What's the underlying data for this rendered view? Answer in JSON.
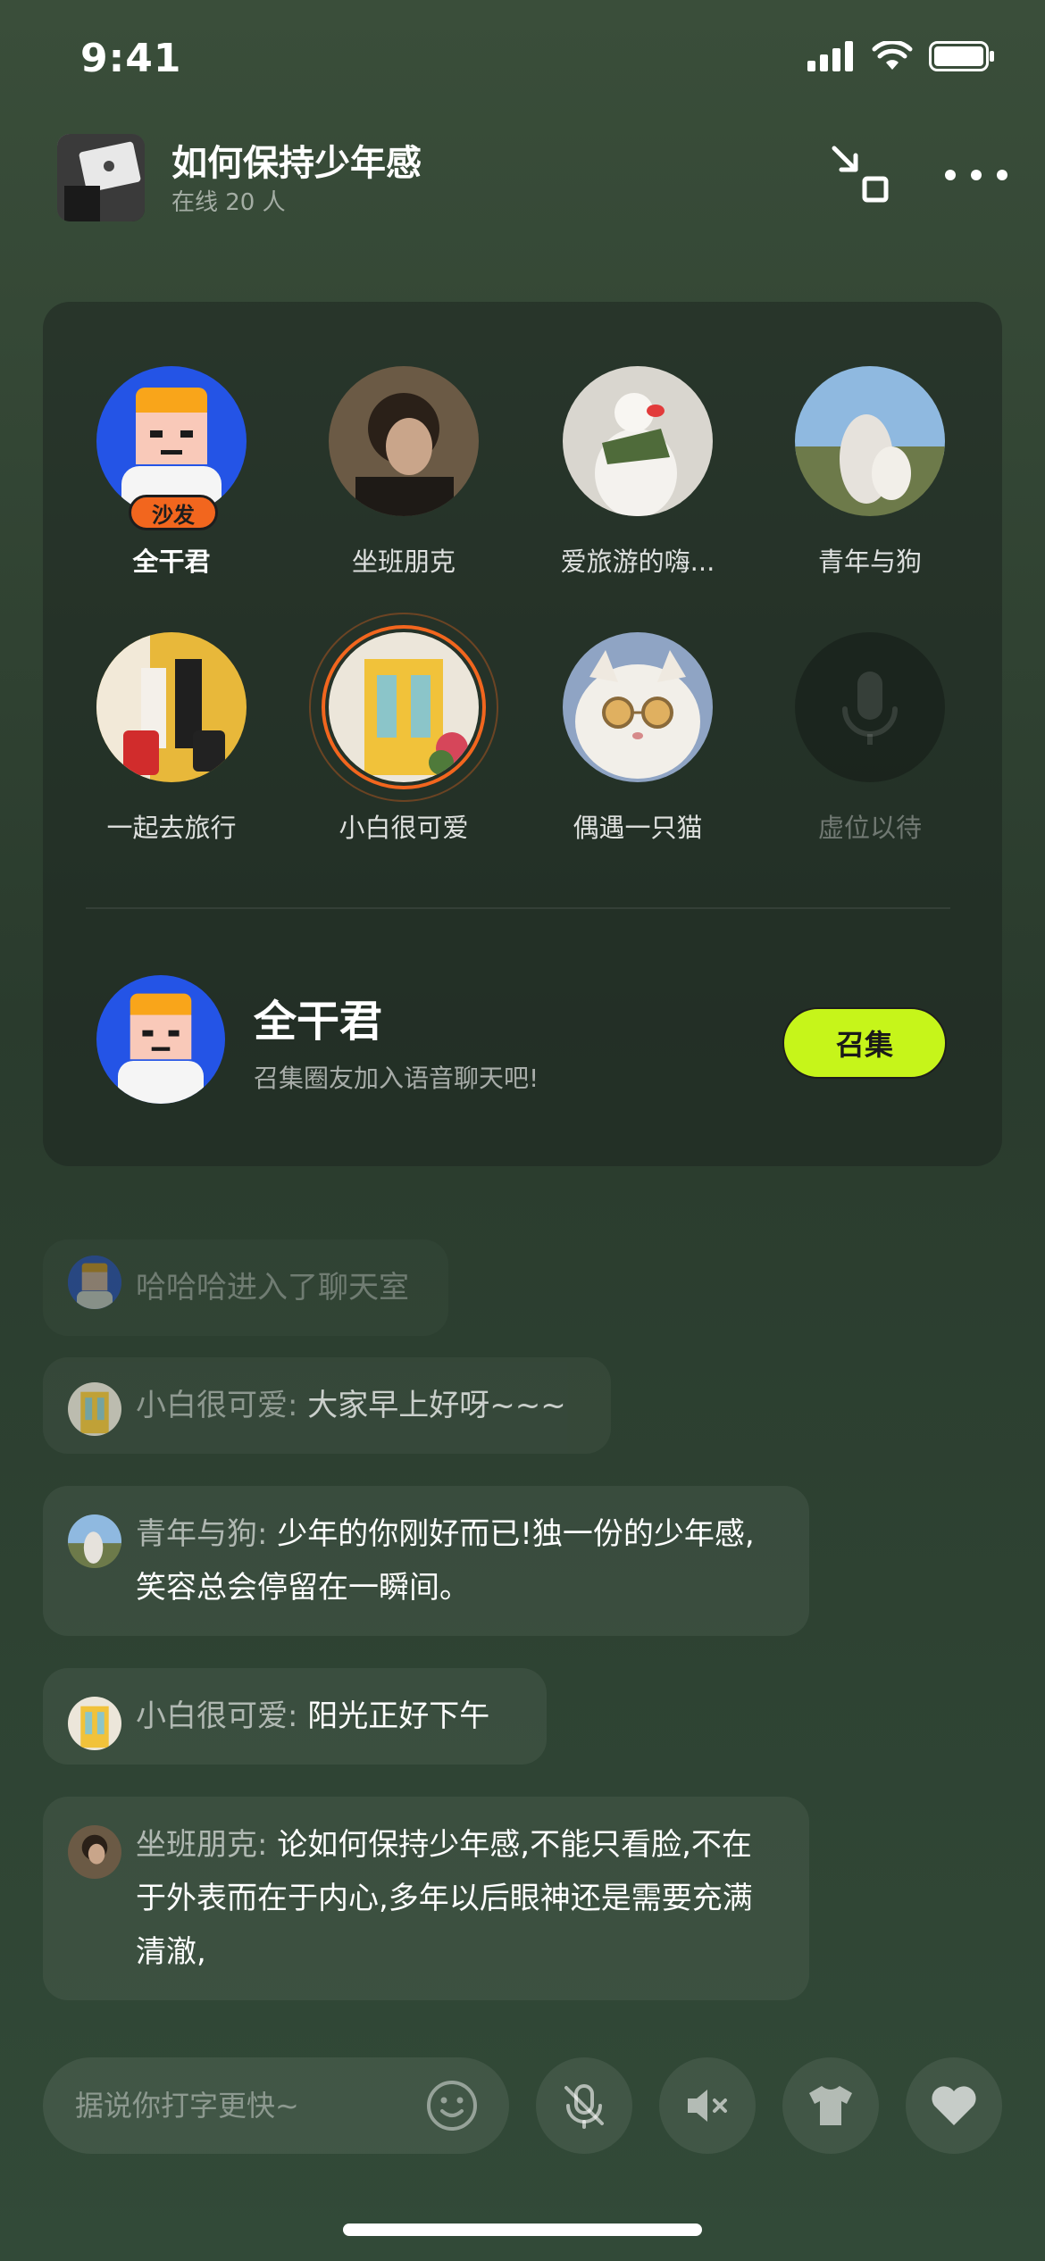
{
  "status_bar": {
    "time": "9:41"
  },
  "room": {
    "title": "如何保持少年感",
    "online": "在线 20 人"
  },
  "seats": [
    {
      "name": "全干君",
      "badge": "沙发",
      "avatar_icon": "cartoon-boy-avatar"
    },
    {
      "name": "坐班朋克",
      "avatar_icon": "photo-avatar"
    },
    {
      "name": "爱旅游的嗨...",
      "avatar_icon": "plush-bird-avatar"
    },
    {
      "name": "青年与狗",
      "avatar_icon": "photo-avatar"
    },
    {
      "name": "一起去旅行",
      "avatar_icon": "photo-avatar"
    },
    {
      "name": "小白很可爱",
      "avatar_icon": "yellow-door-avatar",
      "speaking": true
    },
    {
      "name": "偶遇一只猫",
      "avatar_icon": "cat-avatar"
    },
    {
      "name": "虚位以待",
      "avatar_icon": "microphone-icon",
      "empty": true
    }
  ],
  "host": {
    "name": "全干君",
    "desc": "召集圈友加入语音聊天吧!",
    "button": "召集"
  },
  "messages": [
    {
      "text": "哈哈哈进入了聊天室"
    },
    {
      "who": "小白很可爱:",
      "text": "大家早上好呀~~~"
    },
    {
      "who": "青年与狗:",
      "text": "少年的你刚好而已!独一份的少年感,笑容总会停留在一瞬间。"
    },
    {
      "who": "小白很可爱:",
      "text": "阳光正好下午"
    },
    {
      "who": "坐班朋克:",
      "text": "论如何保持少年感,不能只看脸,不在于外表而在于内心,多年以后眼神还是需要充满清澈,"
    }
  ],
  "input": {
    "placeholder": "据说你打字更快~"
  },
  "colors": {
    "accent": "#c6f51a",
    "sofa": "#f2661e",
    "speaking_ring": "#f2661e"
  },
  "toolbar_icons": [
    "mic-off-icon",
    "speaker-mute-icon",
    "tshirt-icon",
    "heart-icon"
  ]
}
